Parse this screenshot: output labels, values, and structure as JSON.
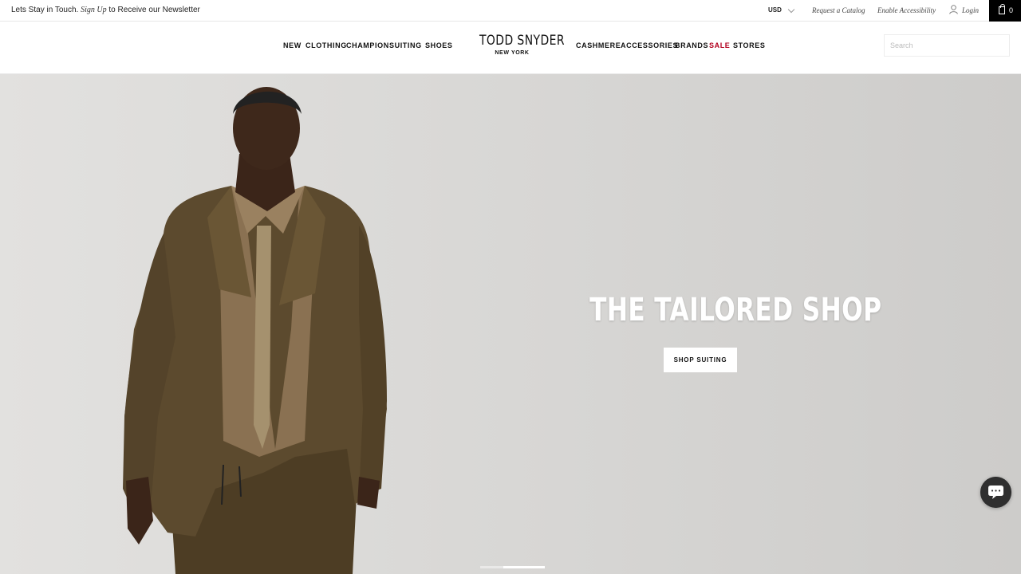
{
  "topbar": {
    "newsletter_prefix": "Lets Stay in Touch.",
    "newsletter_link": "Sign Up",
    "newsletter_suffix": "to Receive our Newsletter",
    "currency": "USD",
    "request_catalog": "Request a Catalog",
    "enable_accessibility": "Enable Accessibility",
    "login": "Login",
    "cart_count": "0"
  },
  "nav": {
    "left": [
      "NEW",
      "CLOTHING",
      "CHAMPION",
      "SUITING",
      "SHOES"
    ],
    "right": [
      "CASHMERE",
      "ACCESSORIES",
      "BRANDS",
      "SALE",
      "STORES"
    ],
    "sale_color": "#b2001e"
  },
  "logo": {
    "brand": "TODD SNYDER",
    "city": "NEW YORK"
  },
  "search": {
    "placeholder": "Search",
    "value": ""
  },
  "hero": {
    "title": "THE TAILORED SHOP",
    "cta": "SHOP SUITING",
    "slide_index": 2,
    "slide_count": 2
  },
  "icons": {
    "user": "user-icon",
    "cart": "shopping-bag-icon",
    "chat": "chat-icon",
    "chevron": "chevron-down-icon"
  }
}
